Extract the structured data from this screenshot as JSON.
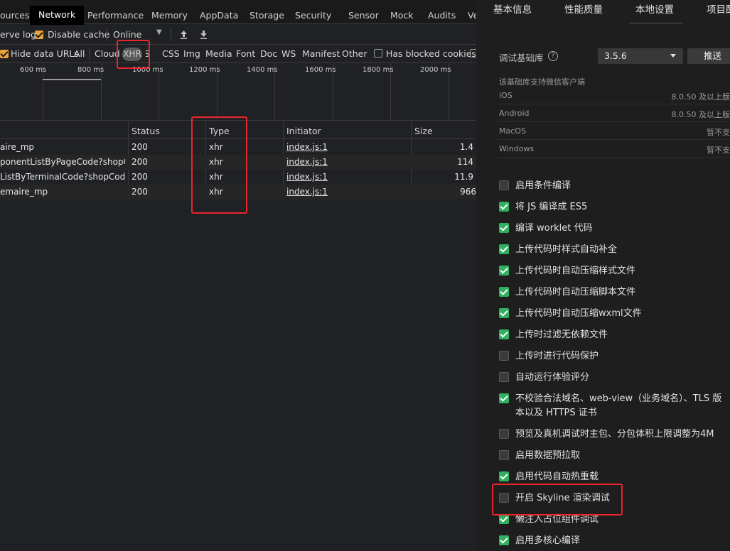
{
  "devtools": {
    "tabs": [
      "ources",
      "Network",
      "Performance",
      "Memory",
      "AppData",
      "Storage",
      "Security",
      "Sensor",
      "Mock",
      "Audits",
      "Ve"
    ],
    "toolbar1": {
      "preserve_log": "erve log",
      "disable_cache": "Disable cache",
      "throttle": "Online"
    },
    "toolbar2": {
      "hide_data_urls": "Hide data URLs",
      "filters": [
        "All",
        "Cloud",
        "XHR",
        "JS",
        "CSS",
        "Img",
        "Media",
        "Font",
        "Doc",
        "WS",
        "Manifest",
        "Other"
      ],
      "has_blocked_cookies": "Has blocked cookies"
    },
    "timeline_ticks": [
      "600 ms",
      "800 ms",
      "1000 ms",
      "1200 ms",
      "1400 ms",
      "1600 ms",
      "1800 ms",
      "2000 ms"
    ],
    "table": {
      "headers": {
        "status": "Status",
        "type": "Type",
        "initiator": "Initiator",
        "size": "Size"
      },
      "rows": [
        {
          "name": "aire_mp",
          "status": "200",
          "type": "xhr",
          "initiator": "index.js:1",
          "size": "1.4"
        },
        {
          "name": "ponentListByPageCode?shopCo...",
          "status": "200",
          "type": "xhr",
          "initiator": "index.js:1",
          "size": "114"
        },
        {
          "name": "ListByTerminalCode?shopCode...",
          "status": "200",
          "type": "xhr",
          "initiator": "index.js:1",
          "size": "11.9"
        },
        {
          "name": "emaire_mp",
          "status": "200",
          "type": "xhr",
          "initiator": "index.js:1",
          "size": "966"
        }
      ]
    }
  },
  "settings": {
    "tabs": [
      "基本信息",
      "性能质量",
      "本地设置",
      "项目配"
    ],
    "base_lib_label": "调试基础库",
    "base_lib_version": "3.5.6",
    "push_label": "推送",
    "support_caption": "该基础库支持微信客户端",
    "platforms": [
      {
        "name": "iOS",
        "value": "8.0.50 及以上版"
      },
      {
        "name": "Android",
        "value": "8.0.50 及以上版"
      },
      {
        "name": "MacOS",
        "value": "暂不支"
      },
      {
        "name": "Windows",
        "value": "暂不支"
      }
    ],
    "options": [
      {
        "label": "启用条件编译",
        "checked": false
      },
      {
        "label": "将 JS 编译成 ES5",
        "checked": true
      },
      {
        "label": "编译 worklet 代码",
        "checked": true
      },
      {
        "label": "上传代码时样式自动补全",
        "checked": true
      },
      {
        "label": "上传代码时自动压缩样式文件",
        "checked": true
      },
      {
        "label": "上传代码时自动压缩脚本文件",
        "checked": true
      },
      {
        "label": "上传代码时自动压缩wxml文件",
        "checked": true
      },
      {
        "label": "上传时过滤无依赖文件",
        "checked": true
      },
      {
        "label": "上传时进行代码保护",
        "checked": false
      },
      {
        "label": "自动运行体验评分",
        "checked": false
      },
      {
        "label": "不校验合法域名、web-view（业务域名）、TLS 版",
        "label_line2": "本以及 HTTPS 证书",
        "checked": true
      },
      {
        "label": "预览及真机调试时主包、分包体积上限调整为4M",
        "checked": false
      },
      {
        "label": "启用数据预拉取",
        "checked": false
      },
      {
        "label": "启用代码自动热重载",
        "checked": true
      },
      {
        "label": "开启 Skyline 渲染调试",
        "checked": false
      },
      {
        "label": "懒注入占位组件调试",
        "checked": true
      },
      {
        "label": "启用多核心编译",
        "checked": true
      }
    ]
  }
}
